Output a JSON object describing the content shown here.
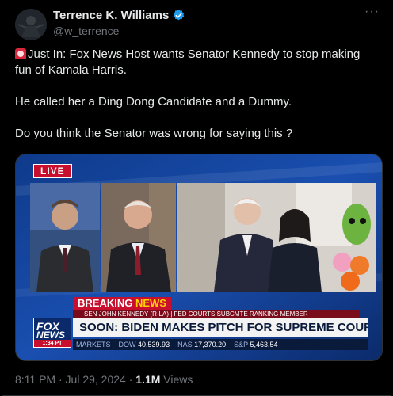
{
  "author": {
    "name": "Terrence K. Williams",
    "handle": "@w_terrence",
    "verified": true
  },
  "more_label": "···",
  "tweet": {
    "line1": "Just In: Fox News Host wants Senator Kennedy to stop making fun of Kamala Harris.",
    "line2": "He called her a Ding Dong Candidate and a Dummy.",
    "line3": "Do you think the Senator was wrong for saying this ?"
  },
  "media": {
    "live_label": "LIVE",
    "breaking_prefix": "BREAKING",
    "breaking_suffix": "NEWS",
    "subtitle": "SEN JOHN KENNEDY (R-LA) | FED COURTS SUBCMTE RANKING MEMBER",
    "headline": "SOON: BIDEN MAKES PITCH FOR SUPREME COURT OVERHAUL",
    "logo_top": "FOX",
    "logo_bottom": "NEWS",
    "logo_time": "1:34 PT",
    "ticker": [
      {
        "label": "MARKETS",
        "value": ""
      },
      {
        "label": "DOW",
        "value": "40,539.93"
      },
      {
        "label": "NAS",
        "value": "17,370.20"
      },
      {
        "label": "S&P",
        "value": "5,463.54"
      }
    ]
  },
  "meta": {
    "time_date": "8:11 PM · Jul 29, 2024 ·",
    "views_count": "1.1M",
    "views_label": "Views"
  },
  "colors": {
    "bg": "#000000",
    "text": "#e7e9ea",
    "muted": "#71767b",
    "verified": "#1d9bf0",
    "fox_red": "#c8102e"
  }
}
